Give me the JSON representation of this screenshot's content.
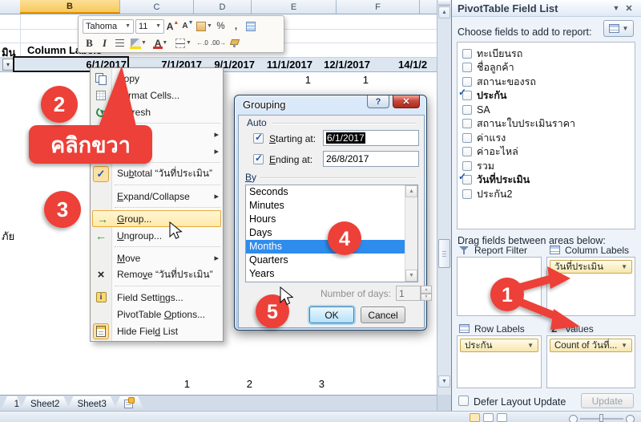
{
  "worksheet": {
    "column_headers": [
      "B",
      "C",
      "D",
      "E",
      "F"
    ],
    "pivot_row_header_partial": "มิน",
    "column_labels_header": "Column Labels",
    "date_labels": [
      "6/1/2017",
      "7/1/2017",
      "9/1/2017",
      "11/1/2017",
      "12/1/2017",
      "14/1/2"
    ],
    "count_values": [
      "1",
      "1"
    ],
    "row_label_partial": "ภัย",
    "bottom_values": [
      "1",
      "2",
      "3"
    ],
    "sheet_tabs": [
      "1",
      "Sheet2",
      "Sheet3"
    ]
  },
  "mini_toolbar": {
    "font_name": "Tahoma",
    "font_size": "11",
    "bold_label": "B",
    "italic_label": "I",
    "percent_label": "%",
    "comma_label": ","
  },
  "context_menu": {
    "items": [
      {
        "icon": "copy-icon",
        "label": "Copy",
        "accel": "C"
      },
      {
        "icon": "format-cells-icon",
        "label": "Format Cells...",
        "accel": "F"
      },
      {
        "icon": "refresh-icon",
        "label": "Refresh",
        "accel": "R"
      },
      {
        "sep": true
      },
      {
        "label": "",
        "submenu": true
      },
      {
        "label": "",
        "submenu": true
      },
      {
        "sep": true
      },
      {
        "icon": "check-icon",
        "label": "Subtotal “วันที่ประเมิน”",
        "accel": "b",
        "active": true
      },
      {
        "sep": true
      },
      {
        "label": "Expand/Collapse",
        "accel": "E",
        "submenu": true
      },
      {
        "sep": true
      },
      {
        "icon": "group-icon",
        "label": "Group...",
        "accel": "G",
        "highlight": true
      },
      {
        "icon": "ungroup-icon",
        "label": "Ungroup...",
        "accel": "U"
      },
      {
        "sep": true
      },
      {
        "label": "Move",
        "accel": "M",
        "submenu": true
      },
      {
        "icon": "remove-icon",
        "label": "Remove “วันที่ประเมิน”",
        "accel": "v"
      },
      {
        "sep": true
      },
      {
        "icon": "field-settings-icon",
        "label": "Field Settings...",
        "accel": "n"
      },
      {
        "label": "PivotTable Options...",
        "accel": "O"
      },
      {
        "icon": "field-list-icon",
        "label": "Hide Field List",
        "accel": "d",
        "accel_occurrence": 2,
        "active": true
      }
    ]
  },
  "grouping_dialog": {
    "title": "Grouping",
    "help_label": "?",
    "close_label": "✕",
    "auto_label": "Auto",
    "starting_label": "Starting at:",
    "starting_accel": "S",
    "starting_value": "6/1/2017",
    "ending_label": "Ending at:",
    "ending_accel": "E",
    "ending_value": "26/8/2017",
    "by_label": "By",
    "by_accel": "B",
    "by_options": [
      "Seconds",
      "Minutes",
      "Hours",
      "Days",
      "Months",
      "Quarters",
      "Years"
    ],
    "by_selected": "Months",
    "number_of_days_label": "Number of days:",
    "number_of_days_value": "1",
    "ok_label": "OK",
    "cancel_label": "Cancel"
  },
  "field_list": {
    "title": "PivotTable Field List",
    "choose_fields_label": "Choose fields to add to report:",
    "fields": [
      {
        "label": "ทะเบียนรถ",
        "checked": false
      },
      {
        "label": "ชื่อลูกค้า",
        "checked": false
      },
      {
        "label": "สถานะของรถ",
        "checked": false
      },
      {
        "label": "ประกัน",
        "checked": true
      },
      {
        "label": "SA",
        "checked": false
      },
      {
        "label": "สถานะใบประเมินราคา",
        "checked": false
      },
      {
        "label": "ค่าแรง",
        "checked": false
      },
      {
        "label": "ค่าอะไหล่",
        "checked": false
      },
      {
        "label": "รวม",
        "checked": false
      },
      {
        "label": "วันที่ประเมิน",
        "checked": true
      },
      {
        "label": "ประกัน2",
        "checked": false
      }
    ],
    "drag_fields_label": "Drag fields between areas below:",
    "report_filter_label": "Report Filter",
    "column_labels_label": "Column Labels",
    "column_labels_field": "วันที่ประเมิน",
    "row_labels_label": "Row Labels",
    "row_labels_field": "ประกัน",
    "values_label": "Values",
    "values_field": "Count of วันที่...",
    "defer_label": "Defer Layout Update",
    "update_label": "Update"
  },
  "annotations": {
    "callout_text": "คลิกขวา",
    "step_1": "1",
    "step_2": "2",
    "step_3": "3",
    "step_4": "4",
    "step_5": "5"
  }
}
